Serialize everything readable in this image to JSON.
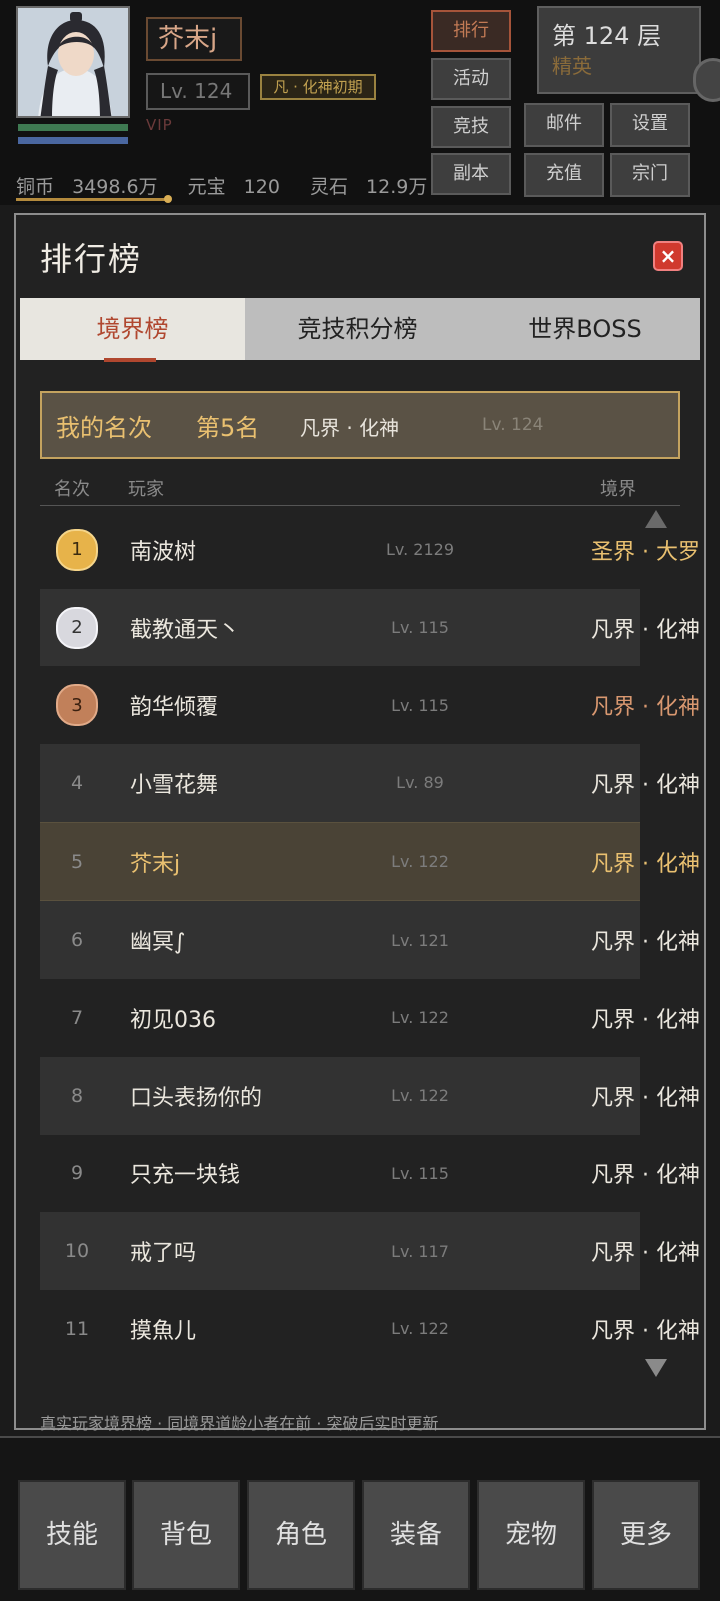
{
  "hud": {
    "player_name": "芥末j",
    "level": "Lv. 124",
    "realm_tag": "凡 · 化神初期",
    "vip": "VIP",
    "currencies": [
      {
        "label": "铜币",
        "value": "3498.6万"
      },
      {
        "label": "元宝",
        "value": "120"
      },
      {
        "label": "灵石",
        "value": "12.9万"
      }
    ],
    "floor": "第 124 层",
    "floor_sub": "精英",
    "buttons": {
      "rank": "排行",
      "activity": "活动",
      "arena": "竞技",
      "dungeon": "副本",
      "mail": "邮件",
      "settings": "设置",
      "recharge": "充值",
      "sect": "宗门"
    }
  },
  "panel": {
    "title": "排行榜",
    "close": "×",
    "tabs": [
      "境界榜",
      "竞技积分榜",
      "世界BOSS"
    ],
    "my_rank": {
      "label": "我的名次",
      "rank": "第5名",
      "realm": "凡界 · 化神",
      "level": "Lv. 124"
    },
    "headers": {
      "rank": "名次",
      "player": "玩家",
      "realm": "境界"
    },
    "rows": [
      {
        "rank": "1",
        "name": "南波树",
        "level": "Lv. 2129",
        "realm": "圣界 · 大罗"
      },
      {
        "rank": "2",
        "name": "截教通天丶",
        "level": "Lv. 115",
        "realm": "凡界 · 化神"
      },
      {
        "rank": "3",
        "name": "韵华倾覆",
        "level": "Lv. 115",
        "realm": "凡界 · 化神"
      },
      {
        "rank": "4",
        "name": "小雪花舞",
        "level": "Lv. 89",
        "realm": "凡界 · 化神"
      },
      {
        "rank": "5",
        "name": "芥末j",
        "level": "Lv. 122",
        "realm": "凡界 · 化神"
      },
      {
        "rank": "6",
        "name": "幽冥∫",
        "level": "Lv. 121",
        "realm": "凡界 · 化神"
      },
      {
        "rank": "7",
        "name": "初见036",
        "level": "Lv. 122",
        "realm": "凡界 · 化神"
      },
      {
        "rank": "8",
        "name": "口头表扬你的",
        "level": "Lv. 122",
        "realm": "凡界 · 化神"
      },
      {
        "rank": "9",
        "name": "只充一块钱",
        "level": "Lv. 115",
        "realm": "凡界 · 化神"
      },
      {
        "rank": "10",
        "name": "戒了吗",
        "level": "Lv. 117",
        "realm": "凡界 · 化神"
      },
      {
        "rank": "11",
        "name": "摸魚儿",
        "level": "Lv. 122",
        "realm": "凡界 · 化神"
      }
    ],
    "footnote": "真实玩家境界榜  ·  同境界道龄小者在前  ·  突破后实时更新"
  },
  "nav": [
    "技能",
    "背包",
    "角色",
    "装备",
    "宠物",
    "更多"
  ],
  "colors": {
    "gold": "#e9c070",
    "bronze": "#d99870",
    "accent_red": "#b0472f",
    "close_red": "#d0392e"
  }
}
